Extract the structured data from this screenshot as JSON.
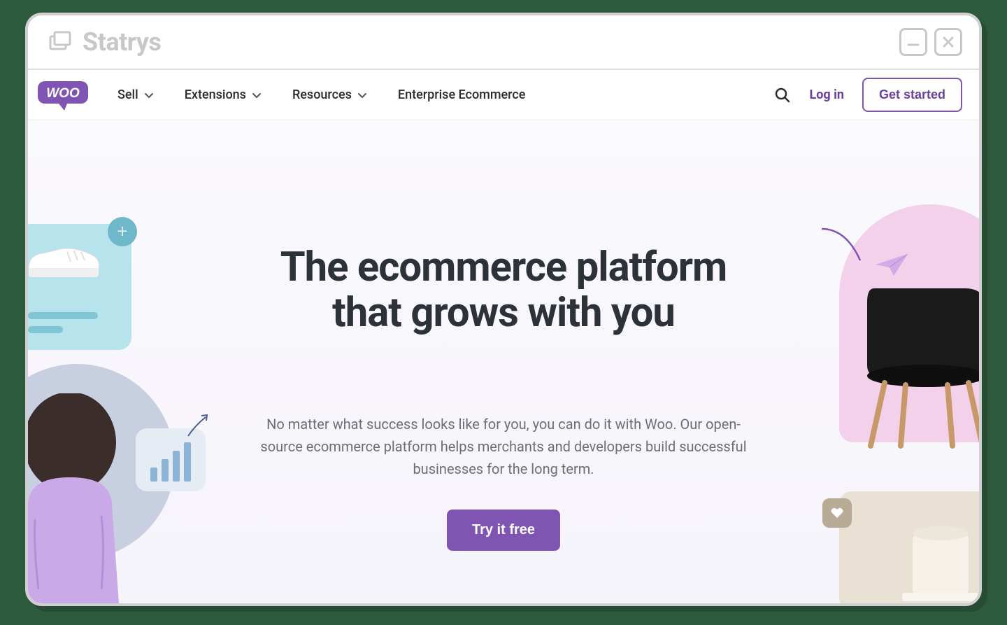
{
  "browser": {
    "brand": "Statrys"
  },
  "nav": {
    "logo": "Woo",
    "items": [
      {
        "label": "Sell",
        "has_dropdown": true
      },
      {
        "label": "Extensions",
        "has_dropdown": true
      },
      {
        "label": "Resources",
        "has_dropdown": true
      },
      {
        "label": "Enterprise Ecommerce",
        "has_dropdown": false
      }
    ],
    "login": "Log in",
    "get_started": "Get started"
  },
  "hero": {
    "title": "The ecommerce platform that grows with you",
    "subtitle": "No matter what success looks like for you, you can do it with Woo. Our open-source ecommerce platform helps merchants and developers build successful businesses for the long term.",
    "cta": "Try it free"
  },
  "colors": {
    "accent": "#7f54b3",
    "hero_bg": "#f6f4fb",
    "text_heading": "#2c3338",
    "text_body": "#6a6f76"
  }
}
